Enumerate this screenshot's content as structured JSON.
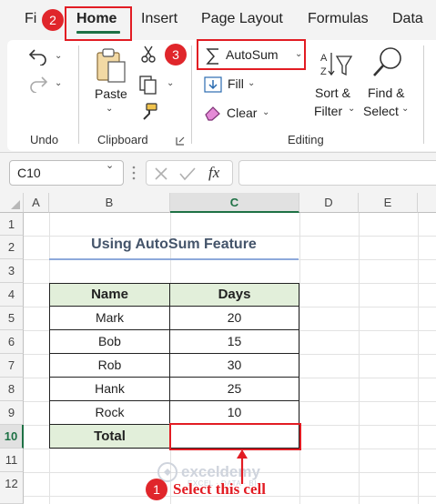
{
  "tabs": [
    {
      "label": "Fi"
    },
    {
      "label": "Home"
    },
    {
      "label": "Insert"
    },
    {
      "label": "Page Layout"
    },
    {
      "label": "Formulas"
    },
    {
      "label": "Data"
    }
  ],
  "ribbon": {
    "undo_group": "Undo",
    "clipboard_group": "Clipboard",
    "editing_group": "Editing",
    "paste_label": "Paste",
    "autosum_label": "AutoSum",
    "fill_label": "Fill",
    "clear_label": "Clear",
    "sort_label_1": "Sort &",
    "sort_label_2": "Filter",
    "find_label_1": "Find &",
    "find_label_2": "Select"
  },
  "formula_bar": {
    "name_box": "C10",
    "fx_label": "fx",
    "formula": ""
  },
  "columns": [
    "A",
    "B",
    "C",
    "D",
    "E"
  ],
  "rows": [
    "1",
    "2",
    "3",
    "4",
    "5",
    "6",
    "7",
    "8",
    "9",
    "10",
    "11",
    "12"
  ],
  "sheet": {
    "title": "Using AutoSum Feature",
    "headers": [
      "Name",
      "Days"
    ],
    "rows": [
      {
        "name": "Mark",
        "days": "20"
      },
      {
        "name": "Bob",
        "days": "15"
      },
      {
        "name": "Rob",
        "days": "30"
      },
      {
        "name": "Hank",
        "days": "25"
      },
      {
        "name": "Rock",
        "days": "10"
      }
    ],
    "total_label": "Total",
    "total_value": ""
  },
  "annotations": {
    "step1": "1",
    "step2": "2",
    "step3": "3",
    "step1_text": "Select this cell",
    "highlight_color": "#e21c23"
  },
  "watermark": {
    "brand": "exceldemy",
    "tagline": "EXCEL · DATA · BI"
  }
}
